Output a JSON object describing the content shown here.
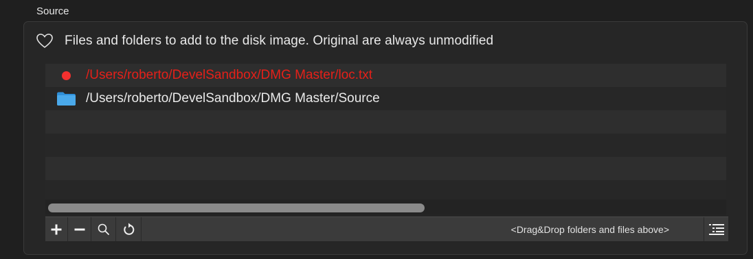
{
  "section": {
    "label": "Source"
  },
  "header": {
    "text": "Files and folders to add to the disk image. Original are always unmodified",
    "icon": "heart-icon"
  },
  "files": [
    {
      "path": "/Users/roberto/DevelSandbox/DMG Master/loc.txt",
      "status": "missing",
      "icon": "red-dot-icon"
    },
    {
      "path": "/Users/roberto/DevelSandbox/DMG Master/Source",
      "status": "ok",
      "icon": "folder-icon"
    }
  ],
  "scrollbar": {
    "thumb_fraction": 0.55
  },
  "toolbar": {
    "add_icon": "plus-icon",
    "remove_icon": "minus-icon",
    "reveal_icon": "magnifier-icon",
    "refresh_icon": "refresh-icon",
    "hint": "<Drag&Drop folders and files above>",
    "list_icon": "list-icon"
  },
  "colors": {
    "background": "#1f1f1f",
    "error_text": "#e52019",
    "folder_blue": "#4aa9ea",
    "red_dot": "#f3302f"
  }
}
